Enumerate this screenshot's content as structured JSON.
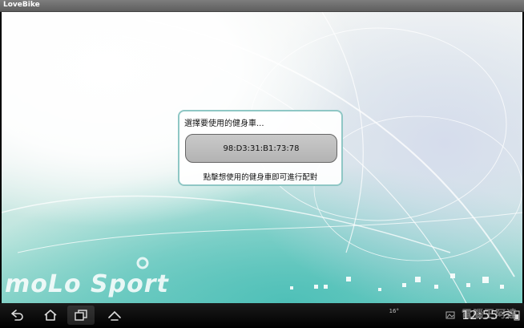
{
  "window": {
    "title": "LoveBike"
  },
  "background": {
    "brand_text": "moLo Sport"
  },
  "dialog": {
    "title": "選擇要使用的健身車...",
    "device_label": "98:D3:31:B1:73:78",
    "hint": "點擊想使用的健身車即可進行配對"
  },
  "navbar": {
    "buttons": [
      "back-icon",
      "home-icon",
      "recent-apps-icon",
      "menu-up-icon"
    ]
  },
  "status": {
    "temperature": "16°",
    "clock": "12:55",
    "watermark": "電腦王阿達"
  },
  "colors": {
    "accent": "#8fc7c5",
    "device_button": "#c0c0c0"
  }
}
